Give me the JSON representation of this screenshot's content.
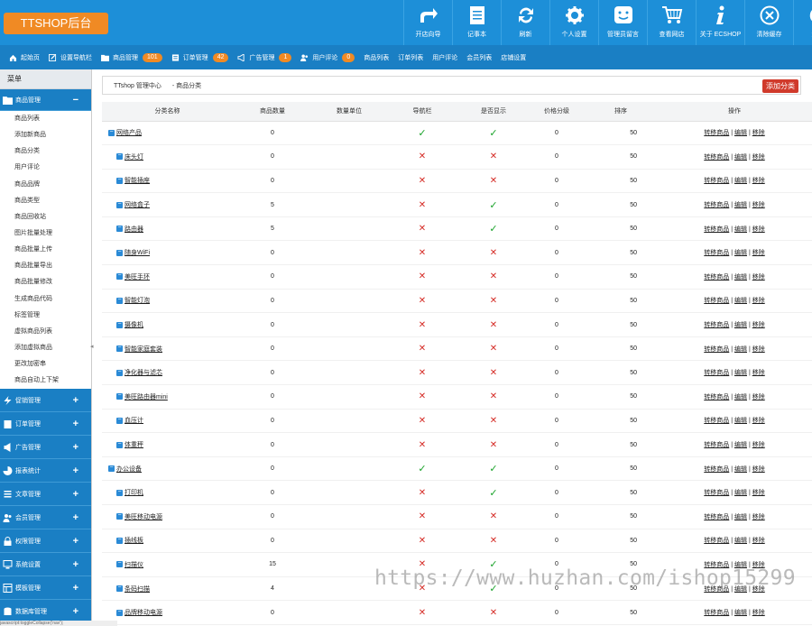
{
  "logo": "TTSHOP后台",
  "toolbar": [
    "开店向导",
    "记事本",
    "刷新",
    "个人设置",
    "管理员留言",
    "查看网店",
    "关于 ECSHOP",
    "清除缓存",
    "退出"
  ],
  "nav": {
    "home": "起始页",
    "setnav": "设置导航栏",
    "goods": "商品管理",
    "goods_count": "101",
    "orders": "订单管理",
    "orders_count": "42",
    "ads": "广告管理",
    "ads_count": "1",
    "comments": "用户评论",
    "comments_count": "0",
    "goods_list": "商品列表",
    "order_list": "订单列表",
    "user_comments": "用户评论",
    "member_list": "会员列表",
    "shop_settings": "店铺设置"
  },
  "sidebar": {
    "title": "菜单",
    "open_group": "商品管理",
    "open_items": [
      "商品列表",
      "添加新商品",
      "商品分类",
      "用户评论",
      "商品品牌",
      "商品类型",
      "商品回收站",
      "图片批量处理",
      "商品批量上传",
      "商品批量导出",
      "商品批量修改",
      "生成商品代码",
      "标签管理",
      "虚拟商品列表",
      "添加虚拟商品",
      "更改加密串",
      "商品自动上下架"
    ],
    "groups": [
      "促销管理",
      "订单管理",
      "广告管理",
      "报表统计",
      "文章管理",
      "会员管理",
      "权限管理",
      "系统设置",
      "模板管理",
      "数据库管理"
    ]
  },
  "main": {
    "crumb_center": "TTshop 管理中心",
    "crumb_page": "- 商品分类",
    "add_button": "添加分类"
  },
  "table": {
    "headers": [
      "分类名称",
      "商品数量",
      "数量单位",
      "导航栏",
      "是否显示",
      "价格分级",
      "排序",
      "操作"
    ],
    "ops": [
      "转移商品",
      "编辑",
      "移除"
    ],
    "rows": [
      {
        "name": "网络产品",
        "count": "0",
        "unit": "",
        "nav": true,
        "show": true,
        "price": "0",
        "sort": "50",
        "top": true
      },
      {
        "name": "床头灯",
        "count": "0",
        "unit": "",
        "nav": false,
        "show": false,
        "price": "0",
        "sort": "50",
        "top": false
      },
      {
        "name": "智能插座",
        "count": "0",
        "unit": "",
        "nav": false,
        "show": false,
        "price": "0",
        "sort": "50",
        "top": false
      },
      {
        "name": "网络盒子",
        "count": "5",
        "unit": "",
        "nav": false,
        "show": true,
        "price": "0",
        "sort": "50",
        "top": false
      },
      {
        "name": "路由器",
        "count": "5",
        "unit": "",
        "nav": false,
        "show": true,
        "price": "0",
        "sort": "50",
        "top": false
      },
      {
        "name": "随身WiFi",
        "count": "0",
        "unit": "",
        "nav": false,
        "show": false,
        "price": "0",
        "sort": "50",
        "top": false
      },
      {
        "name": "美旺手环",
        "count": "0",
        "unit": "",
        "nav": false,
        "show": false,
        "price": "0",
        "sort": "50",
        "top": false
      },
      {
        "name": "智能灯泡",
        "count": "0",
        "unit": "",
        "nav": false,
        "show": false,
        "price": "0",
        "sort": "50",
        "top": false
      },
      {
        "name": "摄像机",
        "count": "0",
        "unit": "",
        "nav": false,
        "show": false,
        "price": "0",
        "sort": "50",
        "top": false
      },
      {
        "name": "智能家庭套装",
        "count": "0",
        "unit": "",
        "nav": false,
        "show": false,
        "price": "0",
        "sort": "50",
        "top": false
      },
      {
        "name": "净化器与滤芯",
        "count": "0",
        "unit": "",
        "nav": false,
        "show": false,
        "price": "0",
        "sort": "50",
        "top": false
      },
      {
        "name": "美旺路由器mini",
        "count": "0",
        "unit": "",
        "nav": false,
        "show": false,
        "price": "0",
        "sort": "50",
        "top": false
      },
      {
        "name": "血压计",
        "count": "0",
        "unit": "",
        "nav": false,
        "show": false,
        "price": "0",
        "sort": "50",
        "top": false
      },
      {
        "name": "体重秤",
        "count": "0",
        "unit": "",
        "nav": false,
        "show": false,
        "price": "0",
        "sort": "50",
        "top": false
      },
      {
        "name": "办公设备",
        "count": "0",
        "unit": "",
        "nav": true,
        "show": true,
        "price": "0",
        "sort": "50",
        "top": true
      },
      {
        "name": "打印机",
        "count": "0",
        "unit": "",
        "nav": false,
        "show": true,
        "price": "0",
        "sort": "50",
        "top": false
      },
      {
        "name": "美旺移动电源",
        "count": "0",
        "unit": "",
        "nav": false,
        "show": false,
        "price": "0",
        "sort": "50",
        "top": false
      },
      {
        "name": "插线板",
        "count": "0",
        "unit": "",
        "nav": false,
        "show": false,
        "price": "0",
        "sort": "50",
        "top": false
      },
      {
        "name": "扫描仪",
        "count": "15",
        "unit": "",
        "nav": false,
        "show": true,
        "price": "0",
        "sort": "50",
        "top": false
      },
      {
        "name": "条码扫描",
        "count": "4",
        "unit": "",
        "nav": false,
        "show": true,
        "price": "0",
        "sort": "50",
        "top": false
      },
      {
        "name": "品牌移动电源",
        "count": "0",
        "unit": "",
        "nav": false,
        "show": false,
        "price": "0",
        "sort": "50",
        "top": false
      }
    ]
  },
  "icons": {
    "ok": "✓",
    "no": "✕",
    "minus": "−",
    "plus": "+"
  },
  "watermark": "https://www.huzhan.com/ishop15299",
  "status": "javascript:toggleCollapse('nav');"
}
